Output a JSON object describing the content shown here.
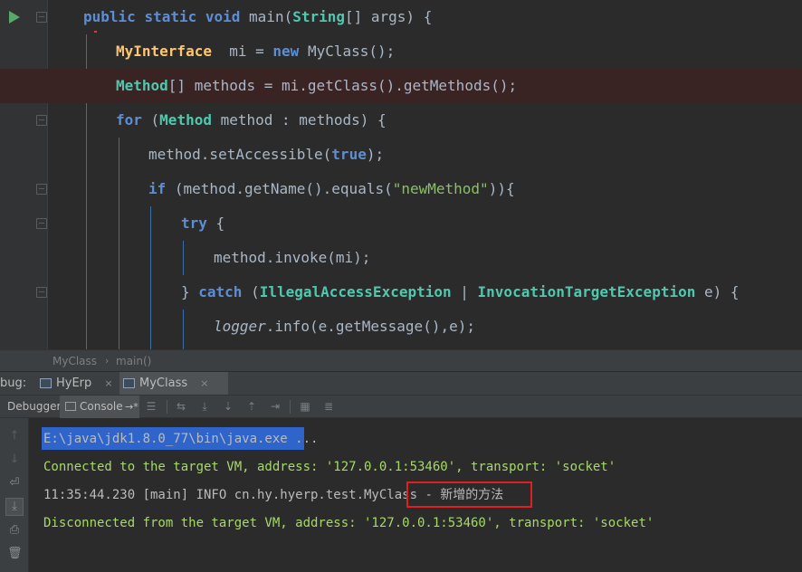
{
  "editor": {
    "lines": [
      {
        "parts": [
          [
            "kw2",
            "public"
          ],
          [
            "txt",
            " "
          ],
          [
            "kw2",
            "static"
          ],
          [
            "txt",
            " "
          ],
          [
            "kw2",
            "void"
          ],
          [
            "txt",
            " main("
          ],
          [
            "type",
            "String"
          ],
          [
            "txt",
            "[] args) {"
          ]
        ]
      },
      {
        "parts": [
          [
            "iface",
            "MyInterface"
          ],
          [
            "txt",
            "  mi = "
          ],
          [
            "kw2",
            "new"
          ],
          [
            "txt",
            " MyClass();"
          ]
        ]
      },
      {
        "parts": [
          [
            "type",
            "Method"
          ],
          [
            "txt",
            "[] methods = mi.getClass().getMethods();"
          ]
        ]
      },
      {
        "parts": [
          [
            "kw2",
            "for"
          ],
          [
            "txt",
            " ("
          ],
          [
            "type",
            "Method"
          ],
          [
            "txt",
            " method : methods) {"
          ]
        ]
      },
      {
        "parts": [
          [
            "txt",
            "method.setAccessible("
          ],
          [
            "kw2",
            "true"
          ],
          [
            "txt",
            ");"
          ]
        ]
      },
      {
        "parts": [
          [
            "kw2",
            "if"
          ],
          [
            "txt",
            " (method.getName().equals("
          ],
          [
            "str",
            "\"newMethod\""
          ],
          [
            "txt",
            ")){"
          ]
        ]
      },
      {
        "parts": [
          [
            "kw2",
            "try"
          ],
          [
            "txt",
            " {"
          ]
        ]
      },
      {
        "parts": [
          [
            "txt",
            "method.invoke(mi);"
          ]
        ]
      },
      {
        "parts": [
          [
            "txt",
            "} "
          ],
          [
            "kw2",
            "catch"
          ],
          [
            "txt",
            " ("
          ],
          [
            "type",
            "IllegalAccessException"
          ],
          [
            "txt",
            " | "
          ],
          [
            "type",
            "InvocationTargetException"
          ],
          [
            "txt",
            " e) {"
          ]
        ]
      },
      {
        "parts": [
          [
            "italic",
            "logger"
          ],
          [
            "txt",
            ".info(e.getMessage(),e);"
          ]
        ]
      }
    ]
  },
  "breadcrumb": {
    "class_name": "MyClass",
    "method_name": "main()"
  },
  "debug_panel": {
    "label": "bug:",
    "tabs": [
      {
        "label": "HyErp"
      },
      {
        "label": "MyClass"
      }
    ],
    "close_glyph": "×",
    "debugger_tab": "Debugger",
    "console_tab": "Console",
    "console_arrow": "→*"
  },
  "console": {
    "command": "E:\\java\\jdk1.8.0_77\\bin\\java.exe ...",
    "connected": "Connected to the target VM, address: '127.0.0.1:53460', transport: 'socket'",
    "log_prefix": "11:35:44.230 [main] INFO cn.hy.hyerp.test.MyClass",
    "log_message": " - 新增的方法",
    "disconnected": "Disconnected from the target VM, address: '127.0.0.1:53460', transport: 'socket'"
  },
  "colors": {
    "keyword": "#5c8ed6",
    "type": "#4ec9b0",
    "string": "#8bbf6a",
    "console_green": "#a6d96a",
    "highlight_box": "#e02020",
    "breakpoint": "#db5c5c",
    "run_arrow": "#59a869"
  },
  "icons": {
    "run": "run-arrow-icon",
    "breakpoint": "breakpoint-icon",
    "side": [
      "up-arrow-icon",
      "down-arrow-icon",
      "soft-wrap-icon",
      "scroll-to-end-icon",
      "print-icon",
      "trash-icon"
    ]
  }
}
